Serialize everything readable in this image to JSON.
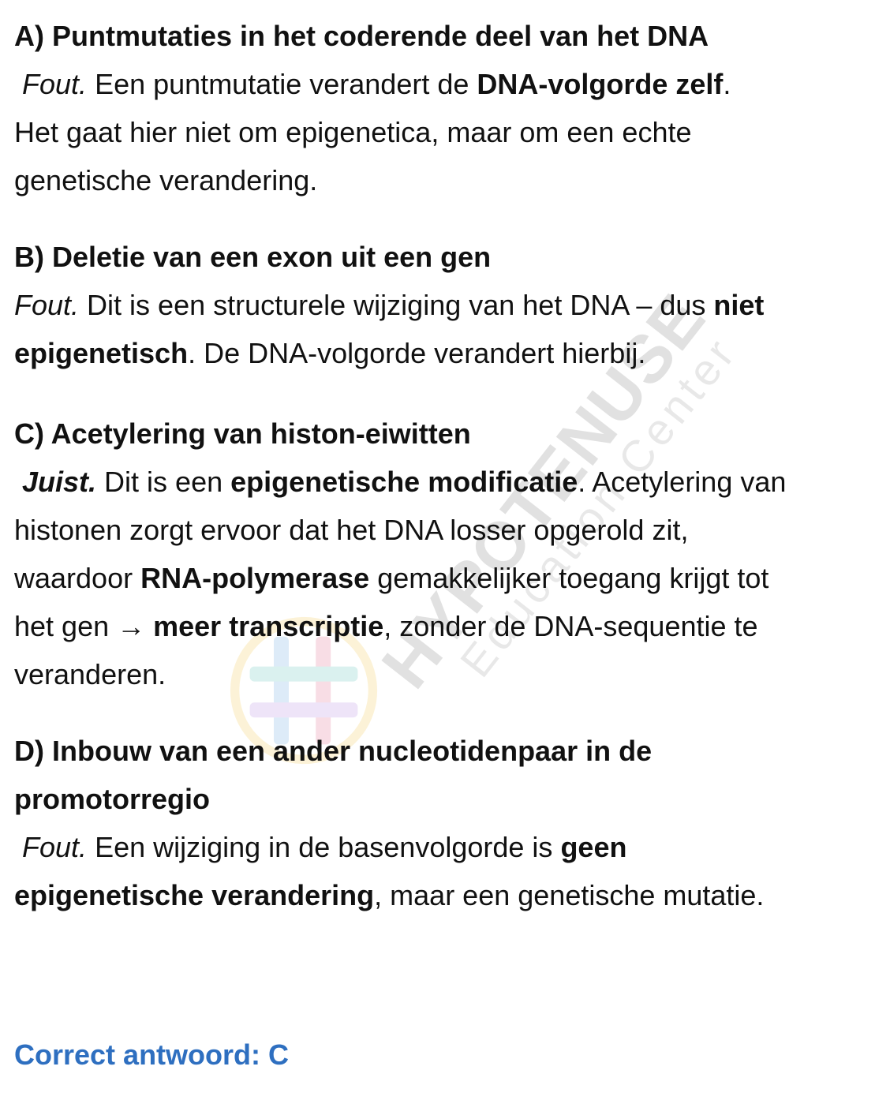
{
  "watermark": {
    "brand": "HYPOTENUSE",
    "subtitle": "Education Center"
  },
  "sections": {
    "a": {
      "heading": "A) Puntmutaties in het coderende deel van het DNA",
      "verdict": "Fout.",
      "l1_text": " Een puntmutatie verandert de ",
      "l1_bold": "DNA-volgorde zelf",
      "l1_end": ".",
      "l2": "Het gaat hier niet om epigenetica, maar om een echte",
      "l3": "genetische verandering."
    },
    "b": {
      "heading": "B) Deletie van een exon uit een gen",
      "verdict": "Fout.",
      "l1_text": " Dit is een structurele wijziging van het DNA – dus ",
      "l1_bold": "niet",
      "l2_bold": "epigenetisch",
      "l2_text": ". De DNA-volgorde verandert hierbij."
    },
    "c": {
      "heading": "C) Acetylering van histon-eiwitten",
      "verdict": "Juist.",
      "l1_text": " Dit is een ",
      "l1_bold": "epigenetische modificatie",
      "l1_end": ". Acetylering van",
      "l2": "histonen zorgt ervoor dat het DNA losser opgerold zit,",
      "l3_text": "waardoor ",
      "l3_bold": "RNA-polymerase",
      "l3_end": " gemakkelijker toegang krijgt tot",
      "l4_text": "het gen → ",
      "l4_bold": "meer transcriptie",
      "l4_end": ", zonder de DNA-sequentie te",
      "l5": "veranderen."
    },
    "d": {
      "heading_l1": "D) Inbouw van een ander nucleotidenpaar in de",
      "heading_l2": "promotorregio",
      "verdict": "Fout.",
      "l1_text": " Een wijziging in de basenvolgorde is ",
      "l1_bold": "geen",
      "l2_bold": "epigenetische verandering",
      "l2_text": ", maar een genetische mutatie."
    }
  },
  "answer": "Correct antwoord: C",
  "colors": {
    "answer": "#2e6fc0",
    "text": "#111111"
  }
}
